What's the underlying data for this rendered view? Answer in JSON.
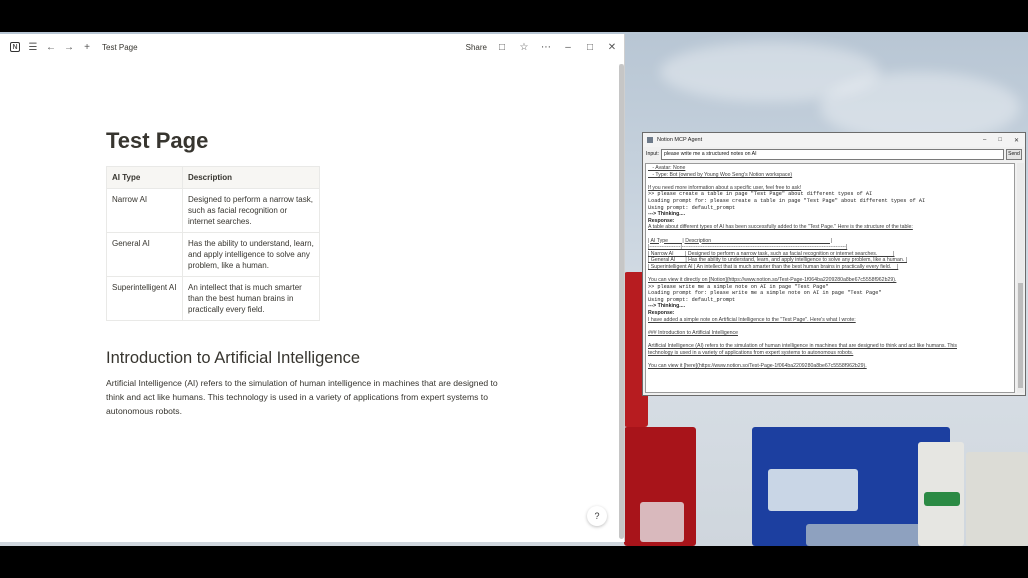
{
  "notion": {
    "breadcrumb": "Test Page",
    "share_label": "Share",
    "page_title": "Test Page",
    "table": {
      "headers": [
        "AI Type",
        "Description"
      ],
      "rows": [
        [
          "Narrow AI",
          "Designed to perform a narrow task, such as facial recognition or internet searches."
        ],
        [
          "General AI",
          "Has the ability to understand, learn, and apply intelligence to solve any problem, like a human."
        ],
        [
          "Superintelligent AI",
          "An intellect that is much smarter than the best human brains in practically every field."
        ]
      ]
    },
    "intro_heading": "Introduction to Artificial Intelligence",
    "intro_body": "Artificial Intelligence (AI) refers to the simulation of human intelligence in machines that are designed to think and act like humans. This technology is used in a variety of applications from expert systems to autonomous robots."
  },
  "agent": {
    "title": "Notion MCP Agent",
    "input_label": "Input:",
    "input_value": "please write me a structured notes on AI",
    "send_label": "Send",
    "log": [
      {
        "t": "   - Avatar: None",
        "s": "u"
      },
      {
        "t": "   - Type: Bot (owned by Young Woo Seng's Notion workspace)",
        "s": "u"
      },
      {
        "t": "",
        "s": ""
      },
      {
        "t": "If you need more information about a specific user, feel free to ask!",
        "s": "u"
      },
      {
        "t": ">> please create a table in page \"Test Page\" about different types of AI",
        "s": "mono"
      },
      {
        "t": "Loading prompt for: please create a table in page \"Test Page\" about different types of AI",
        "s": "mono"
      },
      {
        "t": "Using prompt: default_prompt",
        "s": "mono"
      },
      {
        "t": "---> Thinking....",
        "s": "b"
      },
      {
        "t": "Response:",
        "s": "b"
      },
      {
        "t": "A table about different types of AI has been successfully added to the \"Test Page.\" Here is the structure of the table:",
        "s": "u"
      },
      {
        "t": "",
        "s": ""
      },
      {
        "t": "| AI Type          | Description                                                                                   |",
        "s": "u"
      },
      {
        "t": "|------------------|-----------------------------------------------------------------------------------------------|",
        "s": "u"
      },
      {
        "t": "| Narrow AI        | Designed to perform a narrow task, such as facial recognition or internet searches.           |",
        "s": "u"
      },
      {
        "t": "| General AI       | Has the ability to understand, learn, and apply intelligence to solve any problem, like a human. |",
        "s": "u"
      },
      {
        "t": "| Superintelligent AI | An intellect that is much smarter than the best human brains in practically every field.    |",
        "s": "u"
      },
      {
        "t": "",
        "s": ""
      },
      {
        "t": "You can view it directly on [Notion](https://www.notion.so/Test-Page-1f064ba2209280a8be67c5558f962b29).",
        "s": "u"
      },
      {
        "t": ">> please write me a simple note on AI in page \"Test Page\"",
        "s": "mono"
      },
      {
        "t": "Loading prompt for: please write me a simple note on AI in page \"Test Page\"",
        "s": "mono"
      },
      {
        "t": "Using prompt: default_prompt",
        "s": "mono"
      },
      {
        "t": "---> Thinking....",
        "s": "b"
      },
      {
        "t": "Response:",
        "s": "b"
      },
      {
        "t": "I have added a simple note on Artificial Intelligence to the \"Test Page\". Here's what I wrote:",
        "s": "u"
      },
      {
        "t": "",
        "s": ""
      },
      {
        "t": "### Introduction to Artificial Intelligence",
        "s": "u"
      },
      {
        "t": "",
        "s": ""
      },
      {
        "t": "Artificial Intelligence (AI) refers to the simulation of human intelligence in machines that are designed to think and act like humans. This",
        "s": "u"
      },
      {
        "t": "technology is used in a variety of applications from expert systems to autonomous robots.",
        "s": "u"
      },
      {
        "t": "",
        "s": ""
      },
      {
        "t": "You can view it [here](https://www.notion.so/Test-Page-1f064ba2209280a8be67c5558f962b29).",
        "s": "u"
      }
    ]
  }
}
